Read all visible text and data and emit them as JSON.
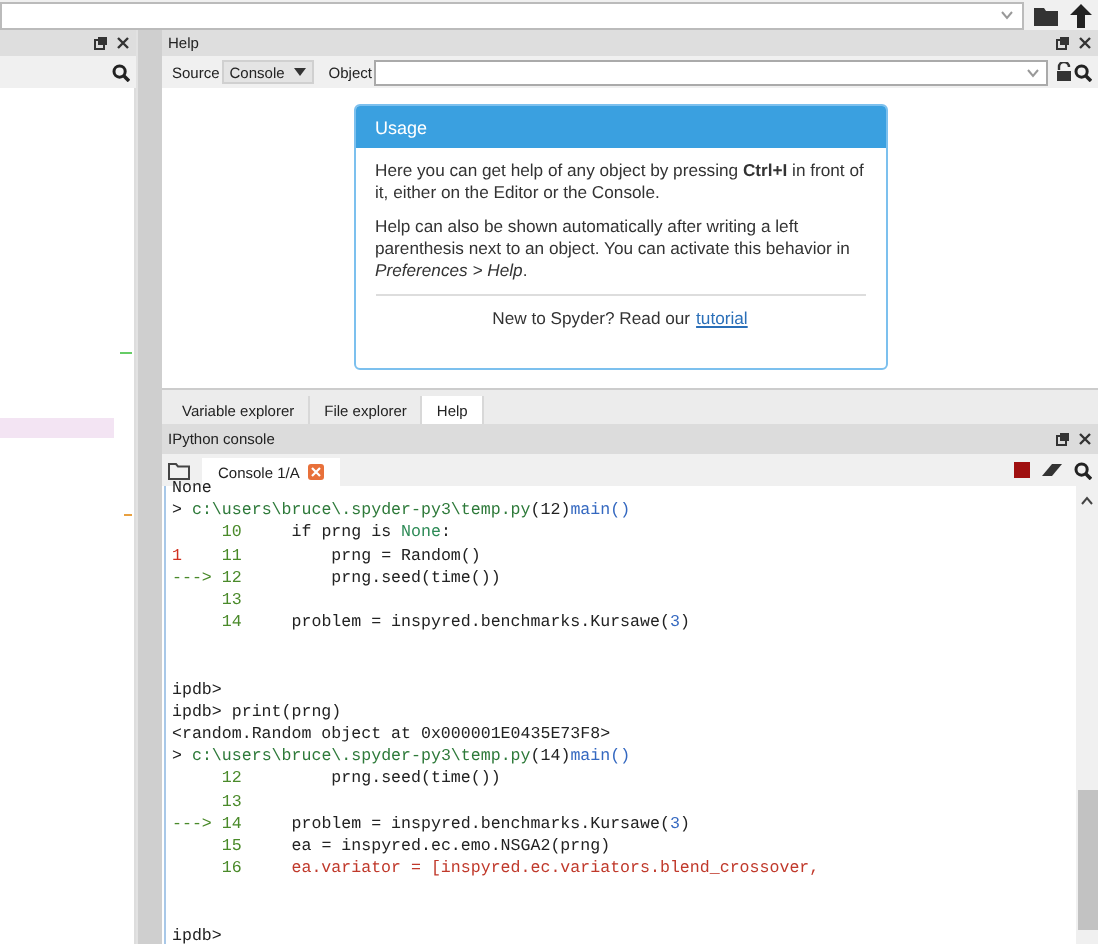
{
  "help_pane": {
    "title": "Help",
    "source_label": "Source",
    "source_value": "Console",
    "object_label": "Object",
    "usage": {
      "title": "Usage",
      "paragraphs": [
        "Here you can get help of any object by pressing **Ctrl+I** in front of it, either on the Editor or the Console.",
        "Help can also be shown automatically after writing a left parenthesis next to an object. You can activate this behavior in *Preferences > Help*."
      ],
      "footer": "New to Spyder? Read our",
      "link": "tutorial"
    }
  },
  "tabs": [
    {
      "label": "Variable explorer",
      "selected": false
    },
    {
      "label": "File explorer",
      "selected": false
    },
    {
      "label": "Help",
      "selected": true
    }
  ],
  "console_pane": {
    "title": "IPython console",
    "tab": {
      "label": "Console 1/A",
      "selected": true
    },
    "lines": [
      {
        "kind": "text",
        "segments": [
          {
            "kind": "plain",
            "text": "None"
          }
        ]
      },
      {
        "kind": "text",
        "segments": [
          {
            "kind": "plain",
            "text": "> "
          },
          {
            "kind": "path",
            "text": "c:\\users\\bruce\\.spyder-py3\\temp.py"
          },
          {
            "kind": "plain",
            "text": "(12)"
          },
          {
            "kind": "func",
            "text": "main()"
          }
        ]
      },
      {
        "kind": "text",
        "segments": [
          {
            "kind": "lineno",
            "text": "     10"
          },
          {
            "kind": "plain",
            "text": "     if prng is "
          },
          {
            "kind": "keyword",
            "text": "None"
          },
          {
            "kind": "plain",
            "text": ":"
          }
        ]
      },
      {
        "kind": "text",
        "segments": [
          {
            "kind": "marker",
            "text": "1"
          },
          {
            "kind": "lineno",
            "text": "    11"
          },
          {
            "kind": "plain",
            "text": "         prng = Random()"
          }
        ]
      },
      {
        "kind": "text",
        "segments": [
          {
            "kind": "lineno",
            "text": "---> 12"
          },
          {
            "kind": "plain",
            "text": "         prng.seed(time())"
          }
        ]
      },
      {
        "kind": "text",
        "segments": [
          {
            "kind": "lineno",
            "text": "     13"
          }
        ]
      },
      {
        "kind": "text",
        "segments": [
          {
            "kind": "lineno",
            "text": "     14"
          },
          {
            "kind": "plain",
            "text": "     problem = inspyred.benchmarks.Kursawe("
          },
          {
            "kind": "number",
            "text": "3"
          },
          {
            "kind": "plain",
            "text": ")"
          }
        ]
      },
      {
        "kind": "blank"
      },
      {
        "kind": "blank"
      },
      {
        "kind": "text",
        "segments": [
          {
            "kind": "plain",
            "text": "ipdb>"
          }
        ]
      },
      {
        "kind": "text",
        "segments": [
          {
            "kind": "plain",
            "text": "ipdb> print(prng)"
          }
        ]
      },
      {
        "kind": "text",
        "segments": [
          {
            "kind": "plain",
            "text": "<random.Random object at 0x000001E0435E73F8>"
          }
        ]
      },
      {
        "kind": "text",
        "segments": [
          {
            "kind": "plain",
            "text": "> "
          },
          {
            "kind": "path",
            "text": "c:\\users\\bruce\\.spyder-py3\\temp.py"
          },
          {
            "kind": "plain",
            "text": "(14)"
          },
          {
            "kind": "func",
            "text": "main()"
          }
        ]
      },
      {
        "kind": "text",
        "segments": [
          {
            "kind": "lineno",
            "text": "     12"
          },
          {
            "kind": "plain",
            "text": "         prng.seed(time())"
          }
        ]
      },
      {
        "kind": "text",
        "segments": [
          {
            "kind": "lineno",
            "text": "     13"
          }
        ]
      },
      {
        "kind": "text",
        "segments": [
          {
            "kind": "lineno",
            "text": "---> 14"
          },
          {
            "kind": "plain",
            "text": "     problem = inspyred.benchmarks.Kursawe("
          },
          {
            "kind": "number",
            "text": "3"
          },
          {
            "kind": "plain",
            "text": ")"
          }
        ]
      },
      {
        "kind": "text",
        "segments": [
          {
            "kind": "lineno",
            "text": "     15"
          },
          {
            "kind": "plain",
            "text": "     ea = inspyred.ec.emo.NSGA2(prng)"
          }
        ]
      },
      {
        "kind": "text",
        "segments": [
          {
            "kind": "lineno",
            "text": "     16     "
          },
          {
            "kind": "error",
            "text": "ea.variator = [inspyred.ec.variators.blend_crossover,"
          }
        ]
      },
      {
        "kind": "blank"
      },
      {
        "kind": "blank"
      },
      {
        "kind": "text",
        "segments": [
          {
            "kind": "plain",
            "text": "ipdb>"
          }
        ]
      }
    ]
  }
}
